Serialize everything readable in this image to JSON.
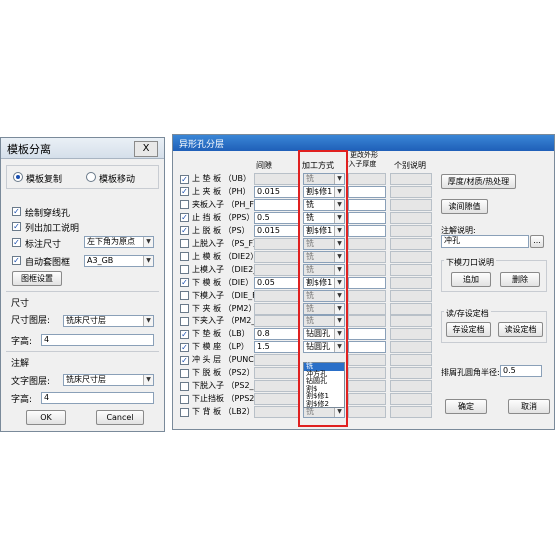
{
  "left": {
    "title": "模板分离",
    "close": "X",
    "radio_copy": "模板复制",
    "radio_move": "模板移动",
    "chk1": "绘制穿线孔",
    "chk2": "列出加工说明",
    "chk3": "标注尺寸",
    "chk3_value": "左下角为原点",
    "chk4": "自动套图框",
    "chk4_value": "A3_GB",
    "frame_btn": "图框设置",
    "size_section": "尺寸",
    "size_layer_label": "尺寸图层:",
    "size_layer_value": "铣床尺寸层",
    "size_height_label": "字高:",
    "size_height_value": "4",
    "note_section": "注解",
    "note_layer_label": "文字图层:",
    "note_layer_value": "铣床尺寸层",
    "note_height_label": "字高:",
    "note_height_value": "4",
    "ok": "OK",
    "cancel": "Cancel"
  },
  "right": {
    "title": "异形孔分层",
    "close": "X",
    "col_gap": "间隙",
    "col_method": "加工方式",
    "col_change_1": "更改外形",
    "col_change_2": "/入子厚度",
    "col_note": "个别说明",
    "rows": [
      {
        "label": "上 垫 板 （UB）",
        "gap": "",
        "method": "铣"
      },
      {
        "label": "上 夹 板 （PH）",
        "gap": "0.015",
        "method": "割$修1"
      },
      {
        "label": "夹板入子 （PH_F）",
        "gap": "",
        "method": "铣"
      },
      {
        "label": "止 挡 板 （PPS）",
        "gap": "0.5",
        "method": "铣"
      },
      {
        "label": "上 脱 板 （PS）",
        "gap": "0.015",
        "method": "割$修1"
      },
      {
        "label": "上脱入子 （PS_F）",
        "gap": "",
        "method": "铣"
      },
      {
        "label": "上 模 板 （DIE2）",
        "gap": "",
        "method": "铣"
      },
      {
        "label": "上模入子 （DIE2_F）",
        "gap": "",
        "method": "铣"
      },
      {
        "label": "下 模 板 （DIE）",
        "gap": "0.05",
        "method": "割$修1"
      },
      {
        "label": "下模入子 （DIE_F）",
        "gap": "",
        "method": "铣"
      },
      {
        "label": "下 夹 板 （PM2）",
        "gap": "",
        "method": "铣"
      },
      {
        "label": "下夹入子 （PM2_F）",
        "gap": "",
        "method": "铣"
      },
      {
        "label": "下 垫 板 （LB）",
        "gap": "0.8",
        "method": "钻圆孔"
      },
      {
        "label": "下 模 座 （LP）",
        "gap": "1.5",
        "method": "钻圆孔"
      },
      {
        "label": "冲 头 层 （PUNCH）",
        "gap": "",
        "method": ""
      },
      {
        "label": "下 脱 板 （PS2）",
        "gap": "",
        "method": ""
      },
      {
        "label": "下脱入子 （PS2_F）",
        "gap": "",
        "method": ""
      },
      {
        "label": "下止挡板 （PPS2）",
        "gap": "",
        "method": ""
      },
      {
        "label": "下 背 板 （LB2）",
        "gap": "",
        "method": "铣"
      }
    ],
    "dropdown_options": [
      "铣",
      "冲方孔",
      "钻圆孔",
      "割$",
      "割$修1",
      "割$修2"
    ],
    "btn_thickness": "厚度/材质/热处理",
    "btn_read_gap": "读间隙值",
    "note_label": "注解说明:",
    "note_value": "冲孔",
    "note_btn": "...",
    "lower_group": "下模刀口说明",
    "btn_add": "追加",
    "btn_delete": "删除",
    "save_group": "读/存设定档",
    "btn_save": "存设定档",
    "btn_read": "读设定档",
    "radius_label": "排屑孔圆角半径:",
    "radius_value": "0.5",
    "ok": "确定",
    "cancel": "取消"
  },
  "colors": {
    "highlight": "#e02020",
    "title_active": "#2a6fc8",
    "checkmark": "#1a4fb0"
  }
}
